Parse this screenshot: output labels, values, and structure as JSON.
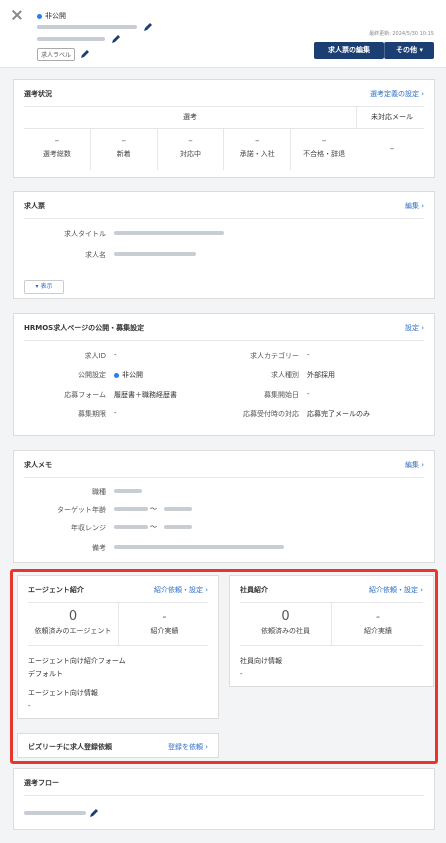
{
  "header": {
    "visibility": "非公開",
    "label_tag": "求人ラベル",
    "updated": "最終更新: 2024/5/30 10:15",
    "edit_button": "求人票の編集",
    "more_button": "その他 ▾"
  },
  "selection_status": {
    "title": "選考状況",
    "link": "選考定義の設定 ›",
    "group_header": "選考",
    "unhandled_header": "未対応メール",
    "columns": [
      {
        "value": "–",
        "label": "選考総数"
      },
      {
        "value": "–",
        "label": "新着"
      },
      {
        "value": "–",
        "label": "対応中"
      },
      {
        "value": "–",
        "label": "承諾・入社"
      },
      {
        "value": "–",
        "label": "不合格・辞退"
      }
    ],
    "unhandled_value": "–"
  },
  "job_ticket": {
    "title": "求人票",
    "link": "編集 ›",
    "rows": [
      {
        "key": "求人タイトル"
      },
      {
        "key": "求人名"
      }
    ],
    "show_button": "▾ 表示"
  },
  "hrmos": {
    "title": "HRMOS求人ページの公開・募集設定",
    "link": "設定 ›",
    "left": [
      {
        "key": "求人ID",
        "value": "-"
      },
      {
        "key": "公開設定",
        "value": "非公開"
      },
      {
        "key": "応募フォーム",
        "value": "履歴書＋職務経歴書"
      },
      {
        "key": "募集期限",
        "value": "-"
      }
    ],
    "right": [
      {
        "key": "求人カテゴリー",
        "value": "-"
      },
      {
        "key": "求人種別",
        "value": "外部採用"
      },
      {
        "key": "募集開始日",
        "value": "-"
      },
      {
        "key": "応募受付時の対応",
        "value": "応募完了メールのみ"
      }
    ]
  },
  "memo": {
    "title": "求人メモ",
    "link": "編集 ›",
    "rows": [
      {
        "key": "職種"
      },
      {
        "key": "ターゲット年齢",
        "sep": "〜"
      },
      {
        "key": "年収レンジ",
        "sep": "〜"
      },
      {
        "key": "備考"
      }
    ]
  },
  "agent": {
    "title": "エージェント紹介",
    "link": "紹介依頼・設定 ›",
    "left_value": "0",
    "left_label": "依頼済みのエージェント",
    "right_value": "-",
    "right_label": "紹介実績",
    "form_title": "エージェント向け紹介フォーム",
    "form_value": "デフォルト",
    "info_title": "エージェント向け情報",
    "info_value": "-"
  },
  "employee": {
    "title": "社員紹介",
    "link": "紹介依頼・設定 ›",
    "left_value": "0",
    "left_label": "依頼済みの社員",
    "right_value": "-",
    "right_label": "紹介実績",
    "info_title": "社員向け情報",
    "info_value": "-"
  },
  "bizreach": {
    "title": "ビズリーチに求人登録依頼",
    "link": "登録を依頼 ›"
  },
  "flow": {
    "title": "選考フロー"
  },
  "colors": {
    "accent": "#2b6cc4",
    "primary_button": "#1b3f73",
    "highlight": "#e8352e"
  }
}
